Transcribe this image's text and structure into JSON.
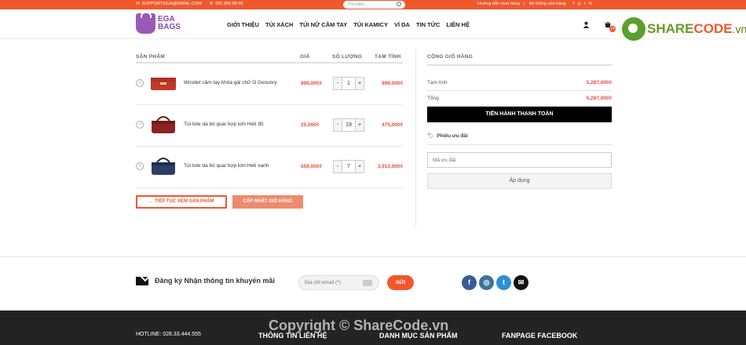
{
  "topbar": {
    "email": "SUPPORT.EGA@GMAIL.COM",
    "phone": "091 900 99 00",
    "search_placeholder": "Tìm kiếm...",
    "link_guide": "Hướng dẫn mua hàng",
    "link_stores": "Hệ thống cửa hàng"
  },
  "logo": {
    "line1": "EGA",
    "line2": "BAGS"
  },
  "nav": [
    "GIỚI THIỆU",
    "TÚI XÁCH",
    "TÚI NỮ CẦM TAY",
    "TÚI KAMICY",
    "VÍ DA",
    "TIN TỨC",
    "LIÊN HỆ"
  ],
  "cart_count": "27",
  "watermark_brand": {
    "a": "SHARE",
    "b": "CODE",
    "c": ".vn"
  },
  "cart": {
    "headers": {
      "product": "SẢN PHẨM",
      "price": "GIÁ",
      "qty": "SỐ LƯỢNG",
      "subtotal": "TẠM TÍNH"
    },
    "items": [
      {
        "name": "Wristlet cầm tay khóa gài chữ O Gesunry",
        "price": "899,000₫",
        "qty": "1",
        "subtotal": "899,000₫",
        "color": "#c0392b"
      },
      {
        "name": "Túi tote da bò quai hợp kim Heti đỏ",
        "price": "25,000₫",
        "qty": "19",
        "subtotal": "475,000₫",
        "color": "#8b2323"
      },
      {
        "name": "Túi tote da bò quai hợp kim Heti xanh",
        "price": "559,000₫",
        "qty": "7",
        "subtotal": "3,913,000₫",
        "color": "#2c3e66"
      }
    ],
    "continue_label": "← TIẾP TỤC XEM SẢN PHẨM",
    "update_label": "CẬP NHẬT GIỎ HÀNG"
  },
  "totals": {
    "title": "CỘNG GIỎ HÀNG",
    "subtotal_label": "Tạm tính",
    "subtotal_value": "5,287,000₫",
    "total_label": "Tổng",
    "total_value": "5,287,000₫",
    "checkout_label": "TIẾN HÀNH THANH TOÁN",
    "coupon_title": "Phiếu ưu đãi",
    "coupon_placeholder": "Mã ưu đãi",
    "apply_label": "Áp dụng"
  },
  "newsletter": {
    "label": "Đăng ký Nhận thông tin khuyến mãi",
    "email_placeholder": "Địa chỉ email (*)",
    "submit": "GỬI"
  },
  "footer": {
    "hotline": "HOTLINE: 028.33.444.555",
    "col2": "THÔNG TIN LIÊN HỆ",
    "col3": "DANH MỤC SẢN PHẨM",
    "col4": "FANPAGE FACEBOOK",
    "watermark": "Copyright © ShareCode.vn"
  }
}
